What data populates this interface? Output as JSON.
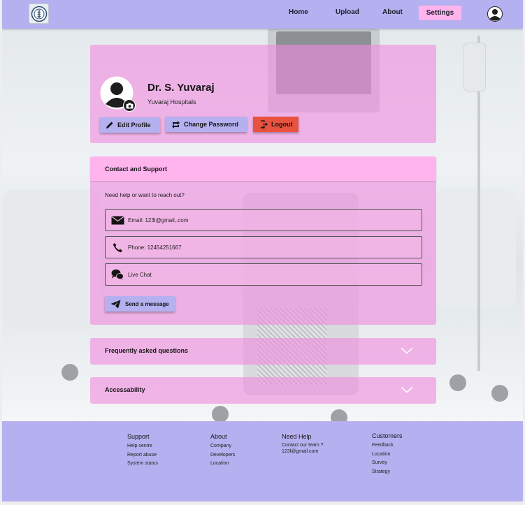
{
  "nav": {
    "links": {
      "home": "Home",
      "upload": "Upload",
      "about": "About",
      "settings": "Settings"
    }
  },
  "profile": {
    "name": "Dr. S. Yuvaraj",
    "hospital": "Yuvaraj Hospitals",
    "edit_label": "Edit Profile",
    "change_password_label": "Change Password",
    "logout_label": "Logout"
  },
  "contact": {
    "title": "Contact and Support",
    "question": "Need help or want to reach out?",
    "email": "Email: 123l@gmail,.com",
    "phone": "Phone: 12454251667",
    "chat": "Live Chat",
    "send_label": "Send a message"
  },
  "accordions": {
    "faq": "Frequently asked questions",
    "accessibility": "Accessability"
  },
  "footer": {
    "support": {
      "heading": "Support",
      "items": [
        "Help centre",
        "Report abuse",
        "System status"
      ]
    },
    "about": {
      "heading": "About",
      "items": [
        "Company",
        "Developers",
        "Location"
      ]
    },
    "need_help": {
      "heading": "Need Help",
      "items": [
        "Contact our team ?",
        "123l@gmail.com"
      ]
    },
    "customers": {
      "heading": "Customers",
      "items": [
        "Feedback",
        "Location",
        "Survey",
        "Strategy"
      ]
    }
  },
  "colors": {
    "nav_bg": "#b5b0ef",
    "active_tab": "#ffb4ee",
    "card_pink": "#f08cde",
    "logout_red": "#e8523e"
  }
}
